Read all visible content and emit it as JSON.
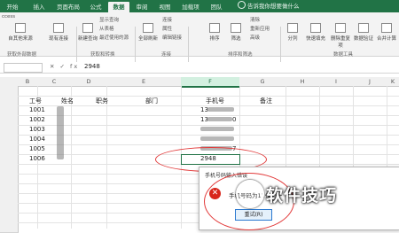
{
  "ribbon": {
    "tabs": [
      "开始",
      "插入",
      "页面布局",
      "公式",
      "数据",
      "审阅",
      "视图",
      "加载项",
      "团队"
    ],
    "active_tab": "数据",
    "tell_me": "告诉我你想要做什么",
    "groups": {
      "get_external": "获取外部数据",
      "get_transform": "获取和转换",
      "connections": "连接",
      "sort_filter": "排序和筛选",
      "data_tools": "数据工具"
    },
    "buttons": {
      "access": "ccess",
      "from_other": "自其他来源",
      "existing": "现有连接",
      "new_query": "新建查询",
      "show_queries": "显示查询",
      "from_table": "从表格",
      "recent_sources": "最近使用的源",
      "refresh_all": "全部刷新",
      "connections": "连接",
      "properties": "属性",
      "edit_links": "编辑链接",
      "sort": "排序",
      "filter": "筛选",
      "clear": "清除",
      "reapply": "重新应用",
      "advanced": "高级",
      "split": "分列",
      "flash_fill": "快速填充",
      "remove_dup": "删除重复项",
      "validation": "数据验证",
      "consolidate": "合并计算"
    }
  },
  "formula_bar": {
    "fx": "✕ ✓ fx",
    "value": "2948"
  },
  "columns": [
    "B",
    "C",
    "D",
    "E",
    "F",
    "G",
    "H",
    "I",
    "J",
    "K"
  ],
  "rows": [
    "",
    "",
    "",
    "",
    "",
    "",
    "",
    "",
    "",
    "",
    "",
    "",
    "",
    "",
    ""
  ],
  "headers": {
    "id": "工号",
    "name": "姓名",
    "title": "职务",
    "dept": "部门",
    "phone": "手机号",
    "note": "备注"
  },
  "records": [
    {
      "id": "1001",
      "phone_a": "13",
      "phone_b": ""
    },
    {
      "id": "1002",
      "phone_a": "13",
      "phone_b": "0"
    },
    {
      "id": "1003",
      "phone_a": "",
      "phone_b": ""
    },
    {
      "id": "1004",
      "phone_a": "",
      "phone_b": ""
    },
    {
      "id": "1005",
      "phone_a": "",
      "phone_b": "7"
    },
    {
      "id": "1006",
      "phone_a": "2948",
      "phone_b": ""
    }
  ],
  "dialog": {
    "title": "手机号码输入错误",
    "message": "手机号码为11位个于",
    "retry": "重试(R)"
  },
  "watermark": "软件技巧",
  "colors": {
    "accent": "#217346",
    "error": "#d8261c",
    "annotation": "#e23a3a"
  }
}
